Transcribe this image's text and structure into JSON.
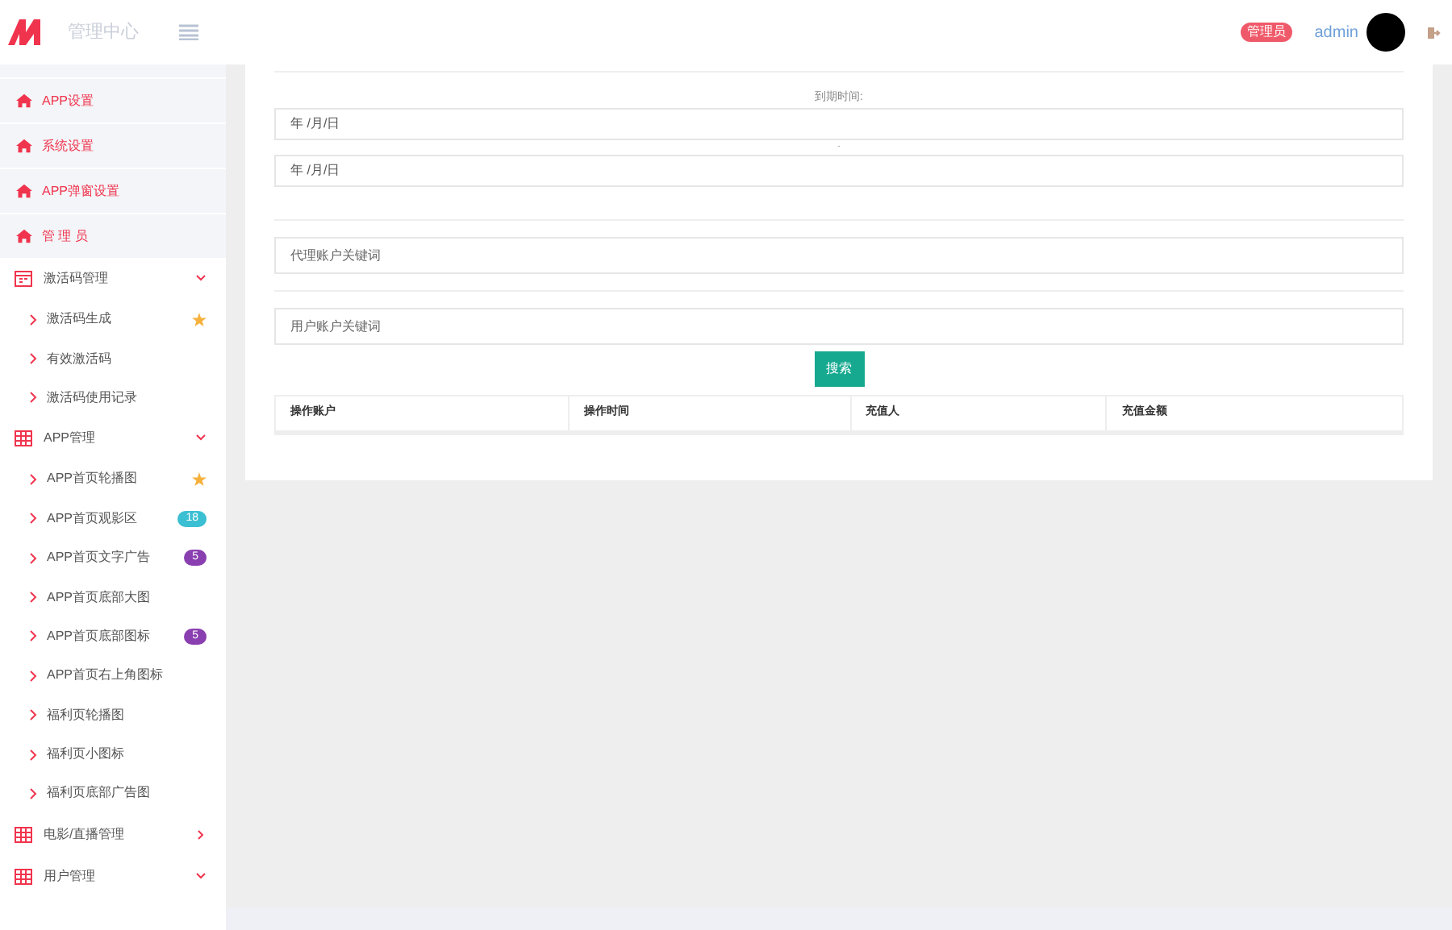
{
  "header": {
    "title": "管理中心",
    "role_badge": "管理员",
    "username": "admin"
  },
  "sidebar": {
    "top_items": [
      {
        "label": "APP设置"
      },
      {
        "label": "系统设置"
      },
      {
        "label": "APP弹窗设置"
      },
      {
        "label": "管 理 员"
      }
    ],
    "groups": [
      {
        "label": "激活码管理",
        "expanded": true,
        "children": [
          {
            "label": "激活码生成",
            "star": true
          },
          {
            "label": "有效激活码"
          },
          {
            "label": "激活码使用记录"
          }
        ]
      },
      {
        "label": "APP管理",
        "expanded": true,
        "children": [
          {
            "label": "APP首页轮播图",
            "star": true
          },
          {
            "label": "APP首页观影区",
            "badge": "18",
            "color": "#3bbfd2"
          },
          {
            "label": "APP首页文字广告",
            "badge": "5",
            "color": "#8a3fb0"
          },
          {
            "label": "APP首页底部大图"
          },
          {
            "label": "APP首页底部图标",
            "badge": "5",
            "color": "#8a3fb0"
          },
          {
            "label": "APP首页右上角图标"
          },
          {
            "label": "福利页轮播图"
          },
          {
            "label": "福利页小图标"
          },
          {
            "label": "福利页底部广告图"
          }
        ]
      },
      {
        "label": "电影/直播管理",
        "expanded": false
      },
      {
        "label": "用户管理",
        "expanded": true
      }
    ]
  },
  "filter": {
    "date_label": "到期时间:",
    "date_from": {
      "placeholder": "年 /月/日"
    },
    "separator": "-",
    "date_to": {
      "placeholder": "年 /月/日"
    },
    "agent_keyword": {
      "placeholder": "代理账户关键词"
    },
    "user_keyword": {
      "placeholder": "用户账户关键词"
    },
    "search_button": "搜索"
  },
  "table": {
    "columns": [
      "操作账户",
      "操作时间",
      "充值人",
      "充值金额"
    ]
  }
}
